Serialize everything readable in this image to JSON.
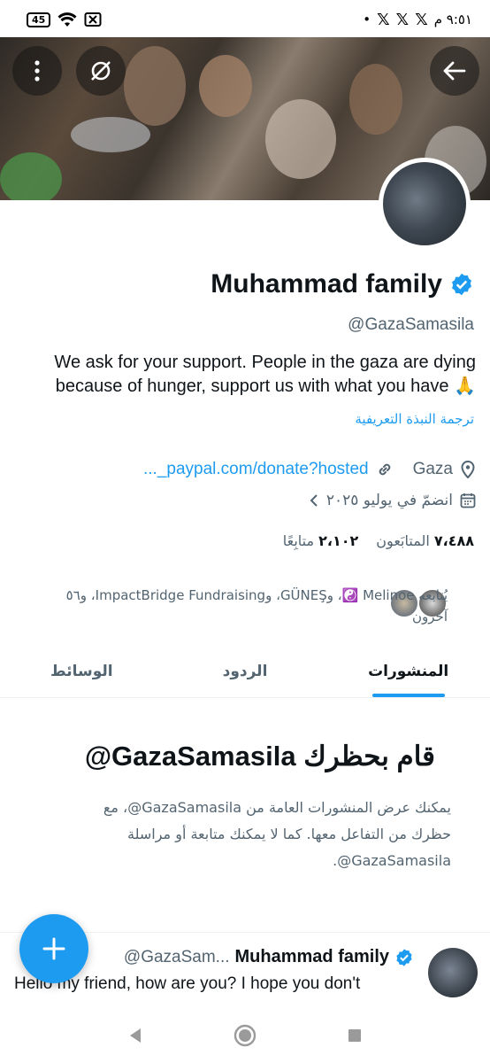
{
  "status_bar": {
    "time": "٩:٥١ م",
    "dot": "•",
    "battery": "45",
    "notification_icons": [
      "x-logo-icon",
      "x-logo-icon",
      "x-logo-icon"
    ]
  },
  "profile": {
    "name": "Muhammad family",
    "handle": "@GazaSamasila",
    "bio": "We ask for your support. People in the gaza are dying because of hunger, support us with what you have 🙏",
    "translate_bio": "ترجمة النبذة التعريفية",
    "location": "Gaza",
    "link": "paypal.com/donate?hosted_...",
    "joined": "انضمّ في يوليو ٢٠٢٥",
    "following_count": "٢،١٠٢",
    "following_label": "متابِعًا",
    "followers_count": "٧،٤٨٨",
    "followers_label": "المتابَعون",
    "followed_by": "يُتابعه Melinoe ☯️، وGÜNEŞ، وImpactBridge Fundraising، و٥٦ آخرون"
  },
  "tabs": [
    {
      "label": "المنشورات",
      "active": true
    },
    {
      "label": "الردود",
      "active": false
    },
    {
      "label": "الوسائط",
      "active": false
    }
  ],
  "blocked": {
    "title": "قام بحظرك GazaSamasila@",
    "description": "يمكنك عرض المنشورات العامة من GazaSamasila@، مع حظرك من التفاعل معها. كما لا يمكنك متابعة أو مراسلة GazaSamasila@."
  },
  "tweet": {
    "name": "Muhammad family",
    "handle": "@GazaSam...",
    "text": "Hello my friend, how are you? I hope you don't"
  },
  "colors": {
    "accent": "#1d9bf0",
    "text": "#0f1419",
    "muted": "#536471"
  }
}
